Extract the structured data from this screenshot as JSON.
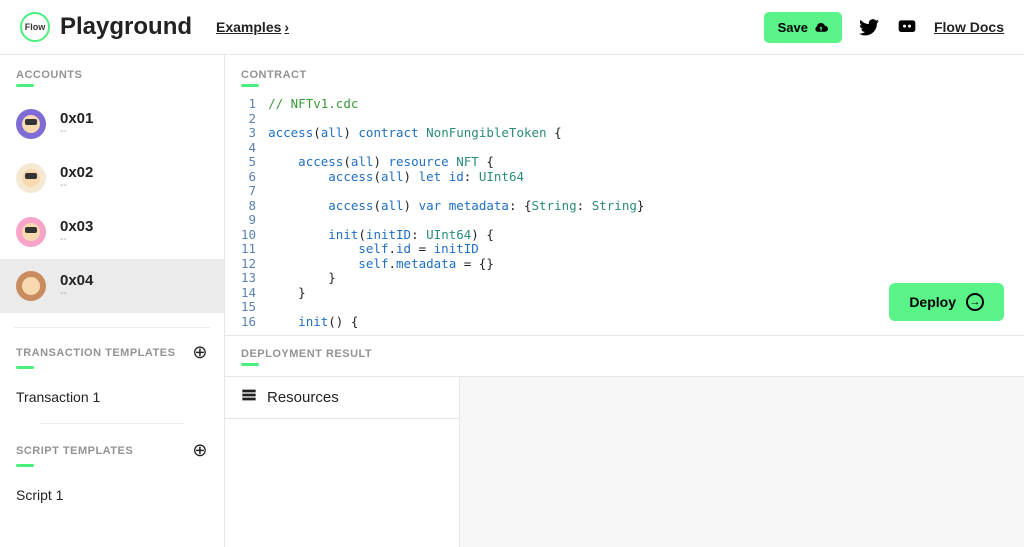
{
  "header": {
    "logo_text": "Flow",
    "app_title": "Playground",
    "examples_label": "Examples",
    "save_label": "Save",
    "docs_label": "Flow Docs"
  },
  "sidebar": {
    "accounts_heading": "ACCOUNTS",
    "accounts": [
      {
        "name": "0x01",
        "sub": "--"
      },
      {
        "name": "0x02",
        "sub": "--"
      },
      {
        "name": "0x03",
        "sub": "--"
      },
      {
        "name": "0x04",
        "sub": "--"
      }
    ],
    "tx_heading": "TRANSACTION TEMPLATES",
    "tx_items": [
      "Transaction 1"
    ],
    "script_heading": "SCRIPT TEMPLATES",
    "script_items": [
      "Script 1"
    ]
  },
  "editor": {
    "heading": "CONTRACT",
    "deploy_label": "Deploy",
    "lines": [
      "// NFTv1.cdc",
      "",
      "access(all) contract NonFungibleToken {",
      "",
      "    access(all) resource NFT {",
      "        access(all) let id: UInt64",
      "",
      "        access(all) var metadata: {String: String}",
      "",
      "        init(initID: UInt64) {",
      "            self.id = initID",
      "            self.metadata = {}",
      "        }",
      "    }",
      "",
      "    init() {"
    ]
  },
  "result": {
    "heading": "DEPLOYMENT RESULT"
  },
  "bottom": {
    "resources_label": "Resources"
  }
}
